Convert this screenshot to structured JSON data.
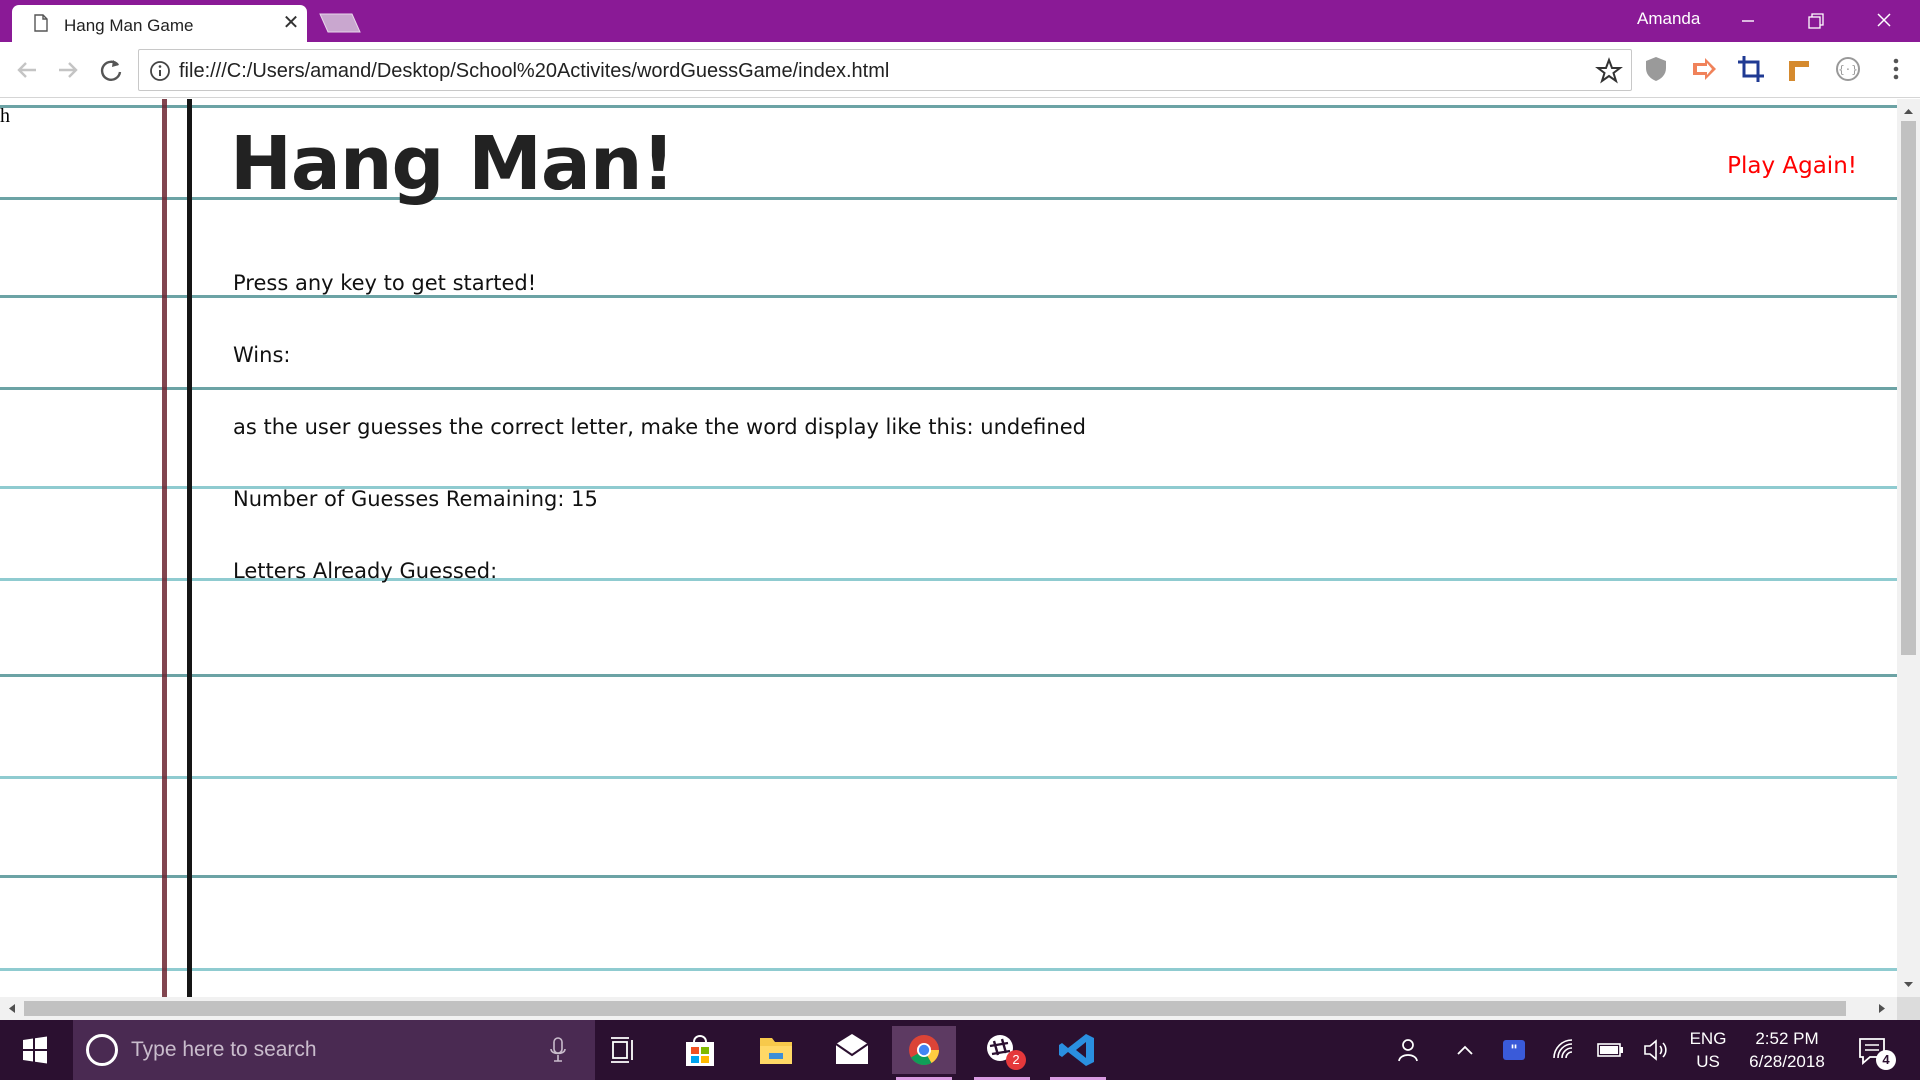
{
  "browser": {
    "tab_title": "Hang Man Game",
    "tab_close": "✕",
    "profile_name": "Amanda",
    "url": "file:///C:/Users/amand/Desktop/School%20Activites/wordGuessGame/index.html",
    "accent_color": "#8a1a96"
  },
  "page": {
    "stray_text": "h",
    "heading": "Hang Man!",
    "play_again": "Play Again!",
    "instruction": "Press any key to get started!",
    "wins": "Wins:",
    "word_display": "as the user guesses the correct letter, make the word display like this: undefined",
    "guesses_remaining": "Number of Guesses Remaining: 15",
    "letters_guessed": "Letters Already Guessed:",
    "play_again_color": "#ff0000"
  },
  "taskbar": {
    "search_placeholder": "Type here to search",
    "language_top": "ENG",
    "language_bottom": "US",
    "time": "2:52 PM",
    "date": "6/28/2018",
    "notification_count": "4",
    "slack_badge": "2",
    "icons": [
      "windows-start-icon",
      "task-view-icon",
      "store-icon",
      "file-explorer-icon",
      "mail-icon",
      "chrome-icon",
      "slack-icon",
      "vscode-icon"
    ]
  }
}
